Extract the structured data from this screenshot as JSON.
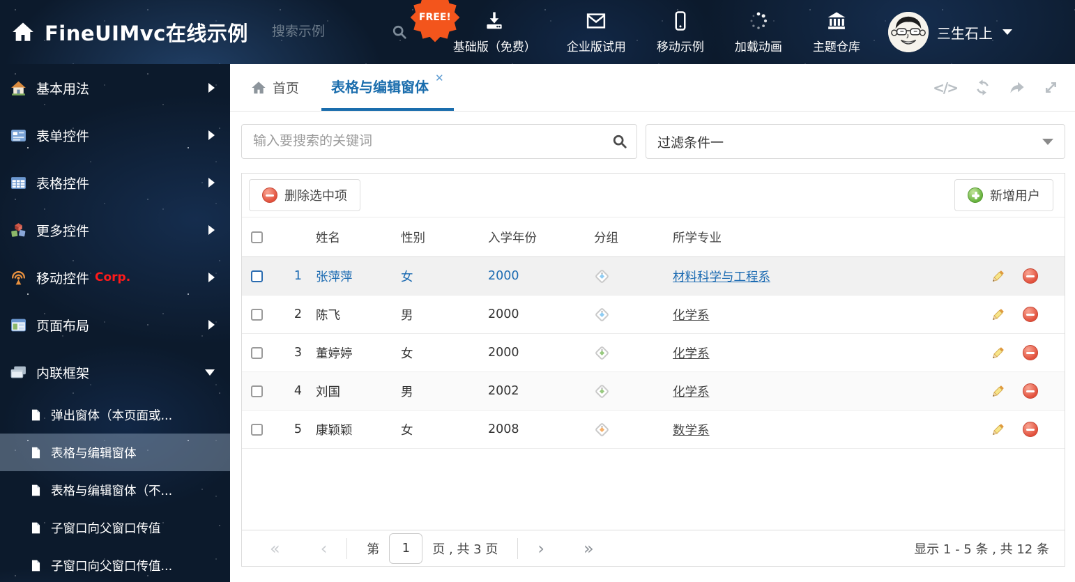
{
  "header": {
    "title": "FineUIMvc在线示例",
    "search_placeholder": "搜索示例",
    "free_badge": "FREE!",
    "nav": [
      {
        "label": "基础版（免费）",
        "icon": "download-icon"
      },
      {
        "label": "企业版试用",
        "icon": "envelope-icon"
      },
      {
        "label": "移动示例",
        "icon": "mobile-icon"
      },
      {
        "label": "加载动画",
        "icon": "spinner-icon"
      },
      {
        "label": "主题仓库",
        "icon": "bank-icon"
      }
    ],
    "user_name": "三生石上"
  },
  "sidebar": {
    "items": [
      {
        "label": "基本用法",
        "icon": "home-icon"
      },
      {
        "label": "表单控件",
        "icon": "form-icon"
      },
      {
        "label": "表格控件",
        "icon": "table-icon"
      },
      {
        "label": "更多控件",
        "icon": "blocks-icon"
      },
      {
        "label": "移动控件",
        "badge": "Corp.",
        "icon": "antenna-icon"
      },
      {
        "label": "页面布局",
        "icon": "layout-icon"
      },
      {
        "label": "内联框架",
        "icon": "frames-icon"
      }
    ],
    "subitems": [
      {
        "label": "弹出窗体（本页面或..."
      },
      {
        "label": "表格与编辑窗体"
      },
      {
        "label": "表格与编辑窗体（不..."
      },
      {
        "label": "子窗口向父窗口传值"
      },
      {
        "label": "子窗口向父窗口传值..."
      }
    ]
  },
  "tabs": {
    "home": "首页",
    "active": "表格与编辑窗体"
  },
  "icons": {
    "code": "</>",
    "close": "✕"
  },
  "filters": {
    "search_placeholder": "输入要搜索的关键词",
    "dropdown_value": "过滤条件一"
  },
  "toolbar": {
    "delete_label": "删除选中项",
    "add_label": "新增用户"
  },
  "table": {
    "columns": [
      "姓名",
      "性别",
      "入学年份",
      "分组",
      "所学专业"
    ],
    "rows": [
      {
        "num": "1",
        "name": "张萍萍",
        "gender": "女",
        "year": "2000",
        "tag_color": "#8fcdf4",
        "major": "材料科学与工程系",
        "selected": true
      },
      {
        "num": "2",
        "name": "陈飞",
        "gender": "男",
        "year": "2000",
        "tag_color": "#8fcdf4",
        "major": "化学系",
        "selected": false
      },
      {
        "num": "3",
        "name": "董婷婷",
        "gender": "女",
        "year": "2000",
        "tag_color": "#97c97e",
        "major": "化学系",
        "selected": false
      },
      {
        "num": "4",
        "name": "刘国",
        "gender": "男",
        "year": "2002",
        "tag_color": "#97c97e",
        "major": "化学系",
        "selected": false
      },
      {
        "num": "5",
        "name": "康颖颖",
        "gender": "女",
        "year": "2008",
        "tag_color": "#f5b06a",
        "major": "数学系",
        "selected": false
      }
    ]
  },
  "pagination": {
    "first": "«",
    "prev": "‹",
    "next": "›",
    "last": "»",
    "page_prefix": "第",
    "page": "1",
    "page_suffix": "页 , 共 3 页",
    "summary": "显示 1 - 5 条 , 共 12 条"
  },
  "colors": {
    "accent": "#1a6dad",
    "delete_red": "#e2503c",
    "add_green": "#66b23c",
    "corp_red": "#ff1a1a"
  }
}
